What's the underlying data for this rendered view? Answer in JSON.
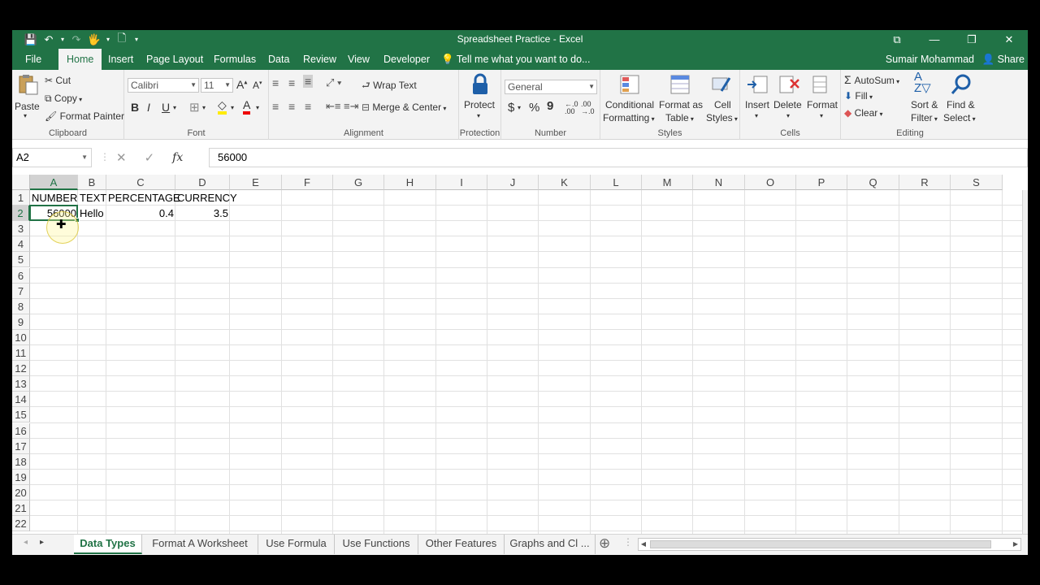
{
  "window": {
    "title": "Spreadsheet Practice - Excel",
    "buttons": [
      "⧉",
      "—",
      "❐",
      "✕"
    ]
  },
  "qat": [
    "💾",
    "↶",
    "▾",
    "↷",
    "🖐",
    "▾",
    "🗋",
    "▾"
  ],
  "tabs": [
    "File",
    "Home",
    "Insert",
    "Page Layout",
    "Formulas",
    "Data",
    "Review",
    "View",
    "Developer"
  ],
  "active_tab": "Home",
  "tell_me": "Tell me what you want to do...",
  "user": "Sumair Mohammad",
  "share": "Share",
  "ribbon": {
    "clipboard": {
      "paste": "Paste",
      "cut": "Cut",
      "copy": "Copy",
      "format_painter": "Format Painter",
      "label": "Clipboard"
    },
    "font": {
      "name": "Calibri",
      "size": "11",
      "bold": "B",
      "italic": "I",
      "underline": "U",
      "label": "Font"
    },
    "alignment": {
      "wrap": "Wrap Text",
      "merge": "Merge & Center",
      "label": "Alignment"
    },
    "protection": {
      "protect": "Protect",
      "label": "Protection"
    },
    "number": {
      "format": "General",
      "label": "Number",
      "dollar": "$",
      "percent": "%",
      "comma": "9"
    },
    "styles": {
      "conditional": "Conditional",
      "formatting": "Formatting",
      "format_as": "Format as",
      "table": "Table",
      "cell": "Cell",
      "cell_styles": "Styles",
      "label": "Styles"
    },
    "cells": {
      "insert": "Insert",
      "delete": "Delete",
      "format": "Format",
      "label": "Cells"
    },
    "editing": {
      "autosum": "AutoSum",
      "fill": "Fill",
      "clear": "Clear",
      "sort": "Sort &",
      "filter": "Filter",
      "find": "Find &",
      "select": "Select",
      "label": "Editing"
    }
  },
  "formula_bar": {
    "name_box": "A2",
    "cancel": "✕",
    "enter": "✓",
    "fx": "fx",
    "value": "56000"
  },
  "columns": [
    "A",
    "B",
    "C",
    "D",
    "E",
    "F",
    "G",
    "H",
    "I",
    "J",
    "K",
    "L",
    "M",
    "N",
    "O",
    "P",
    "Q",
    "R",
    "S"
  ],
  "rows": [
    "1",
    "2",
    "3",
    "4",
    "5",
    "6",
    "7",
    "8",
    "9",
    "10",
    "11",
    "12",
    "13",
    "14",
    "15",
    "16",
    "17",
    "18",
    "19",
    "20",
    "21",
    "22"
  ],
  "cells": {
    "A1": "NUMBER",
    "B1": "TEXT",
    "C1": "PERCENTAGE",
    "D1": "CURRENCY",
    "A2": "56000",
    "B2": "Hello",
    "C2": "0.4",
    "D2": "3.5"
  },
  "selected_cell": "A2",
  "sheets": [
    "Data Types",
    "Format A Worksheet",
    "Use Formula",
    "Use Functions",
    "Other Features",
    "Graphs and Cl ..."
  ],
  "active_sheet": "Data Types",
  "add_sheet": "⊕",
  "nav_prev": "◂",
  "nav_next": "▸"
}
